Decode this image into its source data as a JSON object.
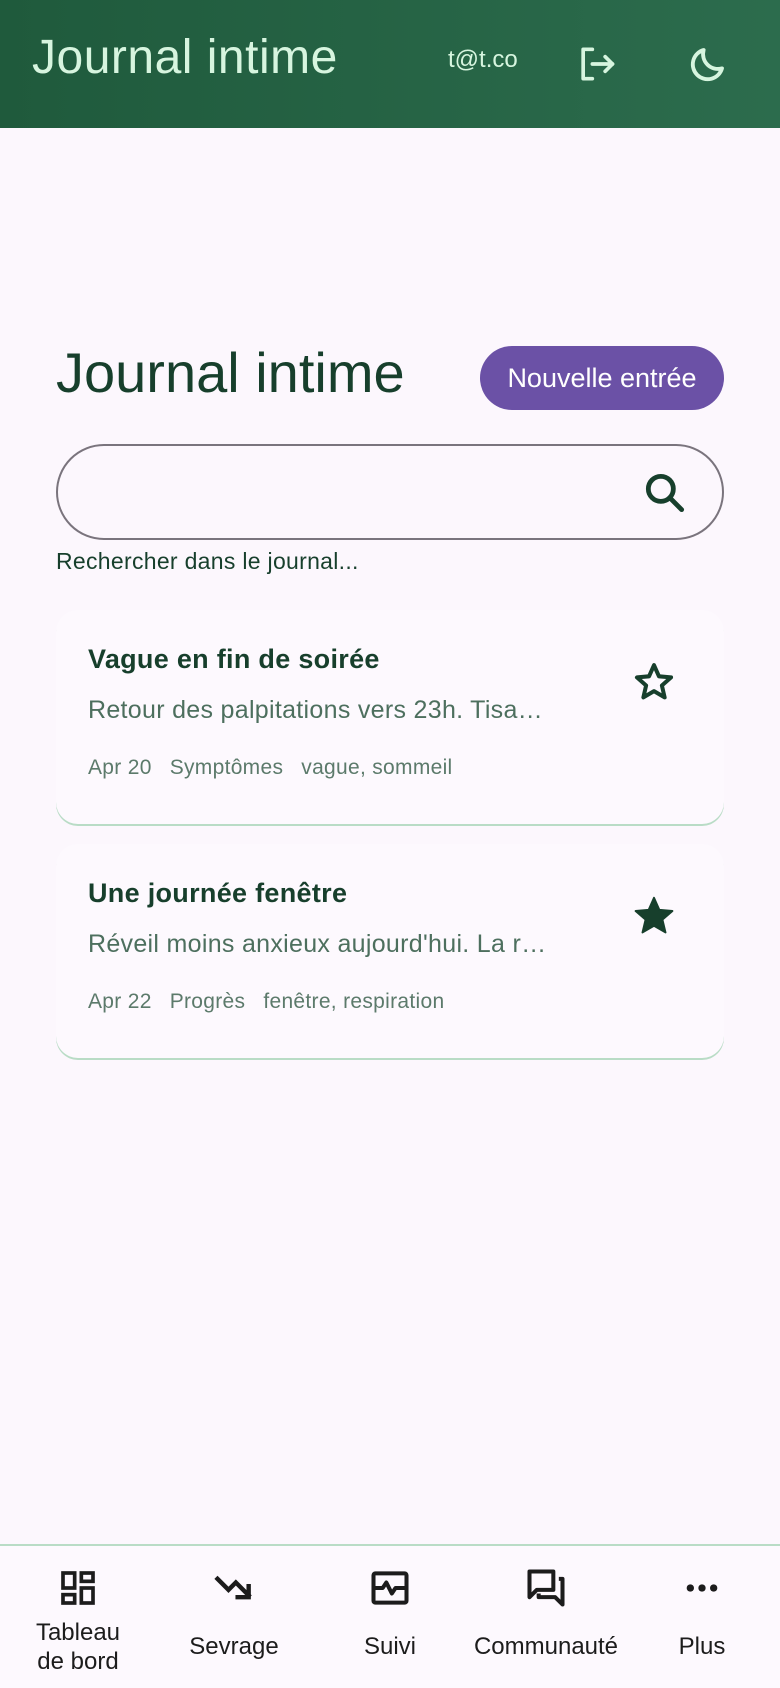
{
  "header": {
    "title": "Journal intime",
    "user_email": "t@t.co",
    "logout_icon": "logout-icon",
    "theme_icon": "moon-icon"
  },
  "main": {
    "heading": "Journal intime",
    "new_entry_label": "Nouvelle entrée",
    "search": {
      "value": "",
      "helper": "Rechercher dans le journal..."
    },
    "entries": [
      {
        "title": "Vague en fin de soirée",
        "preview": "Retour des palpitations vers 23h. Tisa…",
        "date": "Apr 20",
        "category": "Symptômes",
        "tags": "vague, sommeil",
        "favorite": false
      },
      {
        "title": "Une journée fenêtre",
        "preview": "Réveil moins anxieux aujourd'hui. La r…",
        "date": "Apr 22",
        "category": "Progrès",
        "tags": "fenêtre, respiration",
        "favorite": true
      }
    ]
  },
  "bottom_nav": {
    "items": [
      {
        "label": "Tableau de bord",
        "icon": "dashboard-icon"
      },
      {
        "label": "Sevrage",
        "icon": "trending-down-icon"
      },
      {
        "label": "Suivi",
        "icon": "pulse-icon"
      },
      {
        "label": "Communauté",
        "icon": "forum-icon"
      },
      {
        "label": "Plus",
        "icon": "more-horiz-icon"
      }
    ]
  },
  "colors": {
    "header_start": "#1f5a3c",
    "header_end": "#2c6c4d",
    "header_text": "#d7f5df",
    "accent": "#6b51a6",
    "primary_text": "#173f2c",
    "background": "#fcf7fd"
  }
}
